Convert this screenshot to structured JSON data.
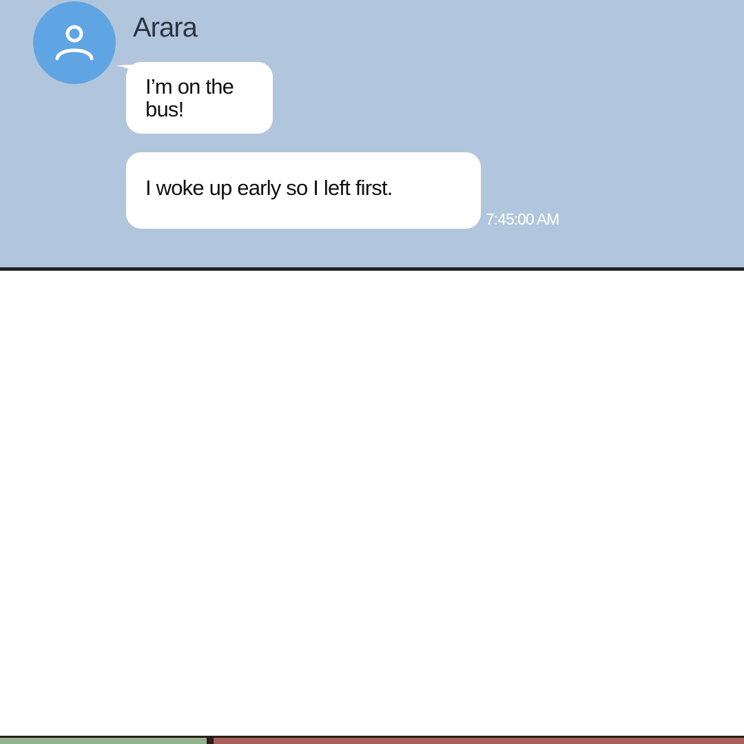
{
  "chat": {
    "sender_name": "Arara",
    "messages": [
      {
        "text": "I’m on the\nbus!"
      },
      {
        "text": "I woke up early so I left first."
      }
    ],
    "timestamp": "7:45:00 AM"
  },
  "icons": {
    "avatar": "person-icon"
  },
  "colors": {
    "chat_background": "#b1c6dc",
    "avatar_background": "#60a5e3",
    "bubble": "#ffffff",
    "panel_border": "#1f2227"
  }
}
